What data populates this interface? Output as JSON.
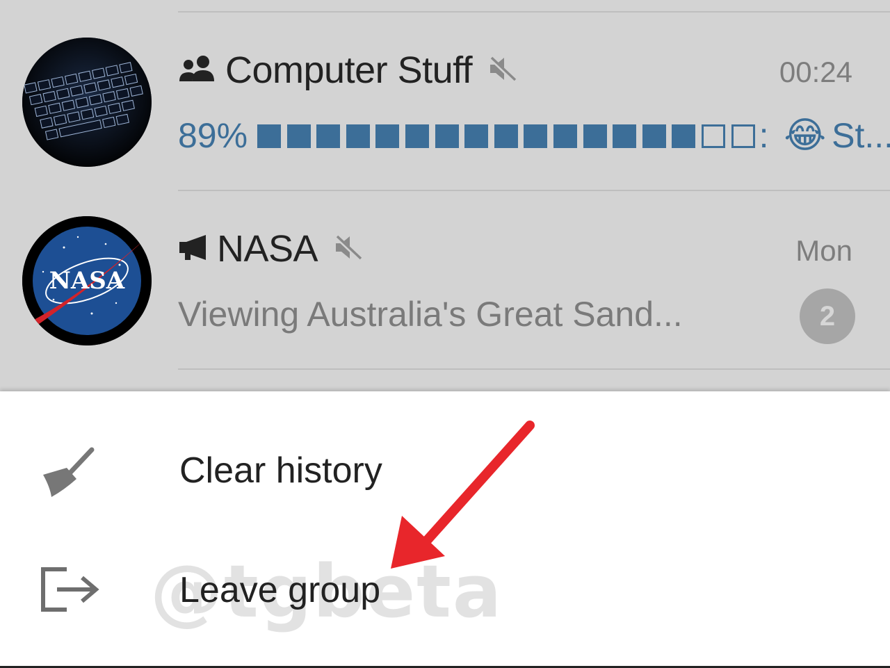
{
  "chats": [
    {
      "name": "Computer Stuff",
      "type_icon": "group-icon",
      "muted": true,
      "time": "00:24",
      "preview_prefix": "89%",
      "progress": {
        "percent": 89,
        "filled_blocks": 15,
        "total_blocks": 17
      },
      "preview_emoji": "😂",
      "preview_suffix": ": ",
      "preview_tail": "St...",
      "avatar": "keyboard-avatar"
    },
    {
      "name": "NASA",
      "type_icon": "megaphone-icon",
      "muted": true,
      "time": "Mon",
      "preview": "Viewing Australia's Great Sand...",
      "unread_count": "2",
      "avatar": "nasa-avatar"
    }
  ],
  "menu": {
    "items": [
      {
        "label": "Clear history",
        "icon": "broom-icon"
      },
      {
        "label": "Leave group",
        "icon": "exit-icon"
      }
    ]
  },
  "watermark": "@tgbeta",
  "colors": {
    "accent_blue": "#3c6e98",
    "arrow_red": "#e8262b",
    "dim_background": "#d3d3d3"
  }
}
